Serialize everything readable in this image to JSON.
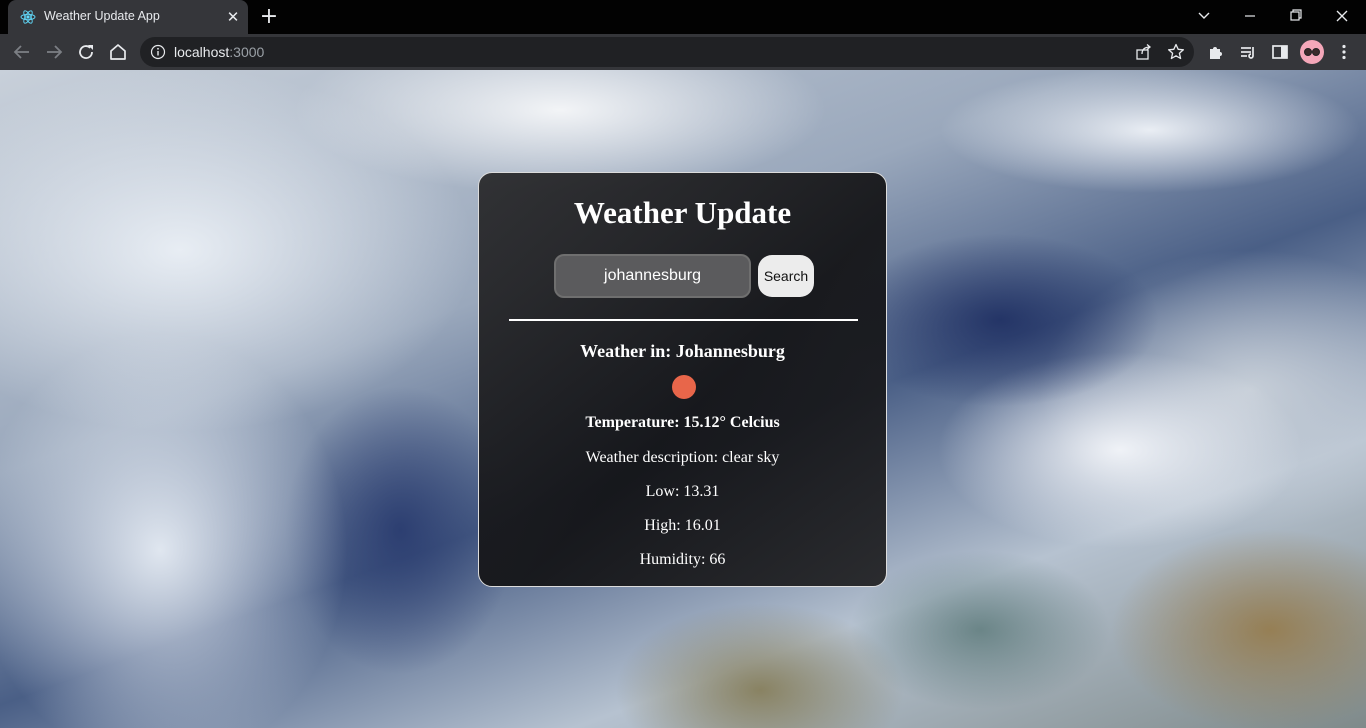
{
  "browser": {
    "tab": {
      "title": "Weather Update App",
      "favicon": "react-icon"
    },
    "newtab_label": "+",
    "close_label": "✕",
    "address": {
      "host": "localhost",
      "port": ":3000"
    },
    "window_controls": [
      "tab-search-icon",
      "minimize-icon",
      "restore-icon",
      "close-icon"
    ],
    "toolbar_icons": [
      "back-arrow-icon",
      "forward-arrow-icon",
      "reload-icon",
      "home-icon"
    ],
    "omnibox_actions": [
      "share-icon",
      "bookmark-star-icon"
    ],
    "extension_icons": [
      "extensions-puzzle-icon",
      "reading-list-icon",
      "side-panel-icon",
      "profile-avatar-icon",
      "menu-kebab-icon"
    ]
  },
  "app": {
    "title": "Weather Update",
    "search": {
      "value": "johannesburg",
      "button_label": "Search"
    },
    "weather": {
      "location_line": "Weather in: Johannesburg",
      "icon": "weather-status-dot-icon",
      "icon_color": "#e8664a",
      "temperature_line": "Temperature: 15.12° Celcius",
      "description_line": "Weather description: clear sky",
      "low_line": "Low: 13.31",
      "high_line": "High: 16.01",
      "humidity_line": "Humidity: 66"
    }
  },
  "colors": {
    "tabstrip_bg": "#020202",
    "toolbar_bg": "#35363a",
    "omnibox_bg": "#202124",
    "card_border": "#dcdcdc",
    "button_bg": "#ececec"
  }
}
